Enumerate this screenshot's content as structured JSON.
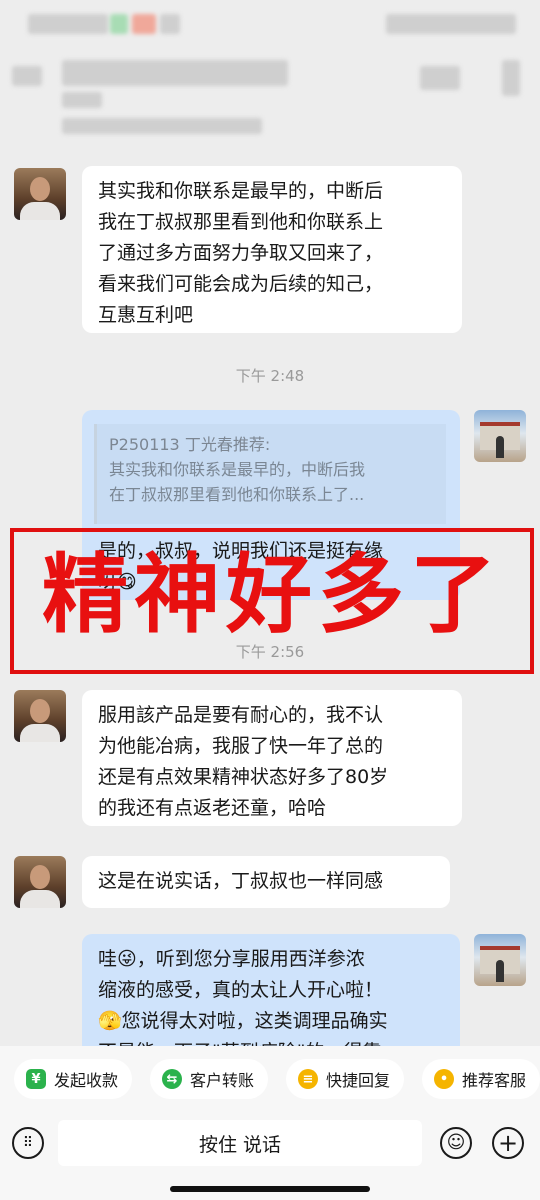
{
  "messages": [
    {
      "side": "in",
      "text": "其实我和你联系是最早的，中断后\n我在丁叔叔那里看到他和你联系上\n了通过多方面努力争取又回来了，\n看来我们可能会成为后续的知己，\n互惠互利吧"
    },
    {
      "side": "time",
      "text": "下午 2:48"
    },
    {
      "side": "out",
      "quote_title": "P250113 丁光春推荐:",
      "quote_text": "其实我和你联系是最早的，中断后我\n在丁叔叔那里看到他和你联系上了...",
      "text": "是的，叔叔，说明我们还是挺有缘\n呀😋"
    },
    {
      "side": "time",
      "text": "下午 2:56"
    },
    {
      "side": "in",
      "text": "服用該产品是要有耐心的，我不认\n为他能冶病，我服了快一年了总的\n还是有点效果精神状态好多了80岁\n的我还有点返老还童，哈哈"
    },
    {
      "side": "in",
      "text": "这是在说实话，丁叔叔也一样同感"
    },
    {
      "side": "out",
      "text": "哇😜，听到您分享服用西洋参浓\n缩液的感受，真的太让人开心啦！\n🫣您说得太对啦，这类调理品确实\n不是能一下子\"药到病除\"的，得靠"
    }
  ],
  "overlay": {
    "text": "精神好多了",
    "color": "#e81010"
  },
  "quick_actions": [
    {
      "label": "发起收款",
      "icon": "yen-icon",
      "color": "#2bb24c"
    },
    {
      "label": "客户转账",
      "icon": "transfer-icon",
      "color": "#2bb24c"
    },
    {
      "label": "快捷回复",
      "icon": "quick-reply-icon",
      "color": "#f5b400"
    },
    {
      "label": "推荐客服",
      "icon": "recommend-icon",
      "color": "#f5b400"
    }
  ],
  "input": {
    "hold_to_talk": "按住 说话"
  }
}
